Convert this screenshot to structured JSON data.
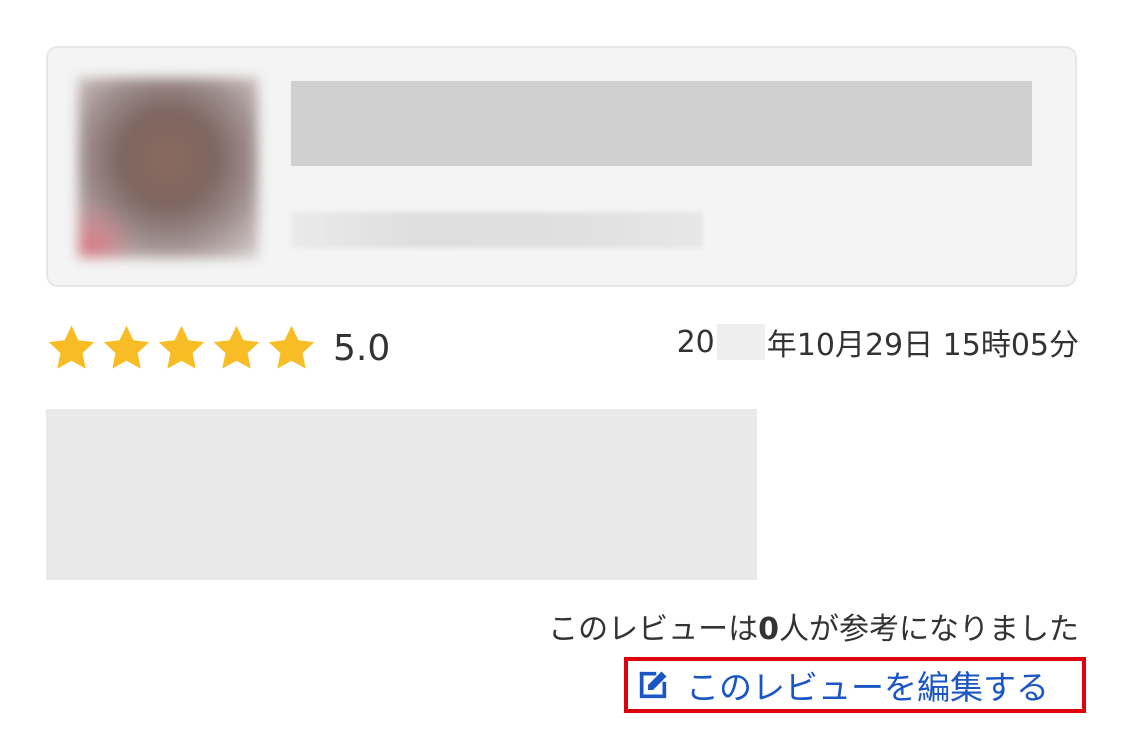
{
  "product": {
    "image_icon": "product-thumbnail-blurred",
    "title": "",
    "subtitle": ""
  },
  "review": {
    "stars_filled": 5,
    "stars_total": 5,
    "star_color": "#f8bd24",
    "rating": "5.0",
    "date_prefix": "20",
    "date_suffix": "年10月29日 15時05分",
    "helpful_prefix": "このレビューは",
    "helpful_count": "0",
    "helpful_suffix": "人が参考になりました",
    "edit_label": "このレビューを編集する",
    "edit_icon": "edit-icon",
    "link_color": "#1a56c4",
    "highlight_color": "#e0000b"
  }
}
